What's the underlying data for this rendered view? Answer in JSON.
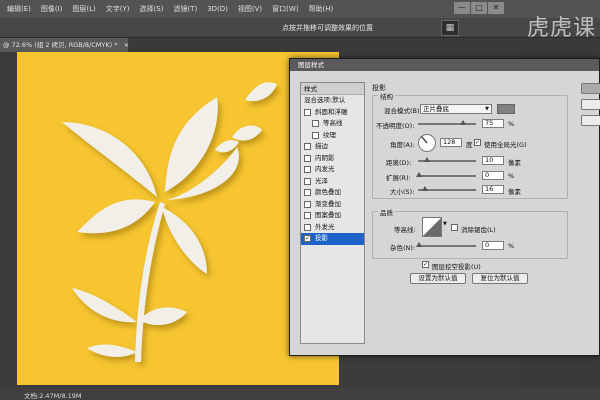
{
  "menu": {
    "items": [
      "编辑(E)",
      "图像(I)",
      "图层(L)",
      "文字(Y)",
      "选择(S)",
      "滤镜(T)",
      "3D(D)",
      "视图(V)",
      "窗口(W)",
      "帮助(H)"
    ]
  },
  "window_controls": {
    "minimize": "—",
    "maximize": "□",
    "close": "✕"
  },
  "options_bar": {
    "hint": "点按并拖移可调整效果的位置",
    "grid_icon": "▦"
  },
  "watermark": {
    "text": "虎课",
    "badge": "虎"
  },
  "document": {
    "tab": "@ 72.6% (组 2 拷贝, RGB/8/CMYK) *",
    "close": "×",
    "status": "文档:2.47M/8.19M",
    "canvas_color": "#f6c530"
  },
  "dialog": {
    "title": "图层样式",
    "styles_header": "样式",
    "styles": [
      {
        "label": "混合选项:默认",
        "checkbox": false,
        "checked": false,
        "sub": false,
        "selected": false
      },
      {
        "label": "斜面和浮雕",
        "checkbox": true,
        "checked": false,
        "sub": false,
        "selected": false
      },
      {
        "label": "等高线",
        "checkbox": true,
        "checked": false,
        "sub": true,
        "selected": false
      },
      {
        "label": "纹理",
        "checkbox": true,
        "checked": false,
        "sub": true,
        "selected": false
      },
      {
        "label": "描边",
        "checkbox": true,
        "checked": false,
        "sub": false,
        "selected": false
      },
      {
        "label": "内阴影",
        "checkbox": true,
        "checked": false,
        "sub": false,
        "selected": false
      },
      {
        "label": "内发光",
        "checkbox": true,
        "checked": false,
        "sub": false,
        "selected": false
      },
      {
        "label": "光泽",
        "checkbox": true,
        "checked": false,
        "sub": false,
        "selected": false
      },
      {
        "label": "颜色叠加",
        "checkbox": true,
        "checked": false,
        "sub": false,
        "selected": false
      },
      {
        "label": "渐变叠加",
        "checkbox": true,
        "checked": false,
        "sub": false,
        "selected": false
      },
      {
        "label": "图案叠加",
        "checkbox": true,
        "checked": false,
        "sub": false,
        "selected": false
      },
      {
        "label": "外发光",
        "checkbox": true,
        "checked": false,
        "sub": false,
        "selected": false
      },
      {
        "label": "投影",
        "checkbox": true,
        "checked": true,
        "sub": false,
        "selected": true
      }
    ],
    "section_title": "投影",
    "structure": {
      "title": "结构",
      "blend_mode_label": "混合模式(B):",
      "blend_mode_value": "正片叠底",
      "shadow_color": "#808080",
      "opacity_label": "不透明度(O):",
      "opacity_value": "75",
      "opacity_unit": "%",
      "angle_label": "角度(A):",
      "angle_value": "128",
      "angle_unit": "度",
      "global_light_label": "使用全局光(G)",
      "global_light_checked": true,
      "distance_label": "距离(D):",
      "distance_value": "10",
      "distance_unit": "像素",
      "spread_label": "扩展(R):",
      "spread_value": "0",
      "spread_unit": "%",
      "size_label": "大小(S):",
      "size_value": "16",
      "size_unit": "像素"
    },
    "quality": {
      "title": "品质",
      "contour_label": "等高线:",
      "antialias_label": "消除锯齿(L)",
      "antialias_checked": false,
      "noise_label": "杂色(N):",
      "noise_value": "0",
      "noise_unit": "%"
    },
    "knockout_label": "图层挖空投影(U)",
    "knockout_checked": true,
    "make_default_label": "设置为默认值",
    "reset_default_label": "复位为默认值",
    "check_mark": "✓"
  }
}
